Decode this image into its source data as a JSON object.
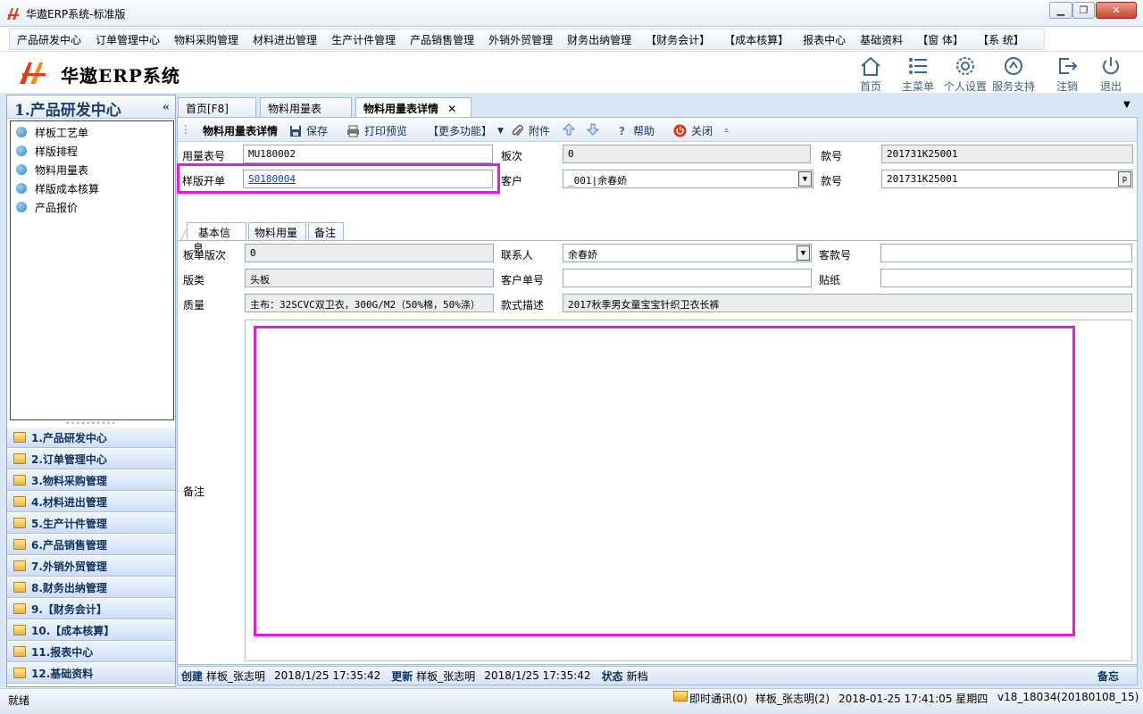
{
  "window": {
    "title": "华遨ERP系统-标准版",
    "logo_glyph": "HA"
  },
  "menu": [
    "产品研发中心",
    "订单管理中心",
    "物料采购管理",
    "材料进出管理",
    "生产计件管理",
    "产品销售管理",
    "外销外贸管理",
    "财务出纳管理",
    "【财务会计】",
    "【成本核算】",
    "报表中心",
    "基础资料",
    "【窗 体】",
    "【系 统】"
  ],
  "brand": {
    "name": "华遨ERP系统",
    "logo_glyph": "HA"
  },
  "header_buttons": [
    {
      "label": "首页",
      "icon": "home-icon"
    },
    {
      "label": "主菜单",
      "icon": "list-icon"
    },
    {
      "label": "个人设置",
      "icon": "gear-icon"
    },
    {
      "label": "服务支持",
      "icon": "support-icon"
    },
    {
      "label": "注销",
      "icon": "logout-icon"
    },
    {
      "label": "退出",
      "icon": "power-icon"
    }
  ],
  "left_panel": {
    "title": "1.产品研发中心",
    "collapse_glyph": "«",
    "sub_items": [
      "样板工艺单",
      "样版排程",
      "物料用量表",
      "样版成本核算",
      "产品报价"
    ],
    "modules": [
      "1.产品研发中心",
      "2.订单管理中心",
      "3.物料采购管理",
      "4.材料进出管理",
      "5.生产计件管理",
      "6.产品销售管理",
      "7.外销外贸管理",
      "8.财务出纳管理",
      "9.【财务会计】",
      "10.【成本核算】",
      "11.报表中心",
      "12.基础资料"
    ]
  },
  "tabs": [
    {
      "label": "首页[F8]"
    },
    {
      "label": "物料用量表"
    },
    {
      "label": "物料用量表详情",
      "close": "✕"
    }
  ],
  "toolbar": {
    "title": "物料用量表详情",
    "save": "保存",
    "print_preview": "打印预览",
    "more": "【更多功能】",
    "attachment": "附件",
    "help": "帮助",
    "close": "关闭"
  },
  "form": {
    "usage_no_label": "用量表号",
    "usage_no": "MU180002",
    "board_order_label": "板次",
    "board_order": "0",
    "style_no_label": "款号",
    "style_no": "201731K25001",
    "sample_order_label": "样版开单",
    "sample_order": "S0180004",
    "customer_label": "客户",
    "customer": "_001|余春娇",
    "style_no2_label": "款号",
    "style_no2": "201731K25001",
    "style_no2_btn": "p"
  },
  "subtabs": [
    "基本信息",
    "物料用量",
    "备注"
  ],
  "basic": {
    "version_label": "板单版次",
    "version": "0",
    "contact_label": "联系人",
    "contact": "余春娇",
    "cust_style_label": "客款号",
    "cust_style": "",
    "category_label": "版类",
    "category": "头板",
    "cust_order_label": "客户单号",
    "cust_order": "",
    "sticker_label": "贴纸",
    "sticker": "",
    "quality_label": "质量",
    "quality": "主布：32SCVC双卫衣，300G/M2（50%棉，50%涤）",
    "desc_label": "款式描述",
    "desc": "2017秋季男女童宝宝针织卫衣长裤",
    "remark_label": "备注",
    "remark": ""
  },
  "info_bar": {
    "created_label": "创建",
    "created_by": "样板_张志明",
    "created_at": "2018/1/25 17:35:42",
    "updated_label": "更新",
    "updated_by": "样板_张志明",
    "updated_at": "2018/1/25 17:35:42",
    "status_label": "状态",
    "status": "新档",
    "memo": "备忘"
  },
  "status_bar": {
    "ready": "就绪",
    "im": "即时通讯(0)",
    "user": "样板_张志明(2)",
    "datetime": "2018-01-25  17:41:05 星期四",
    "version": "v18_18034(20180108_15)"
  },
  "colors": {
    "highlight": "#e51fd1",
    "accent": "#10335c"
  }
}
